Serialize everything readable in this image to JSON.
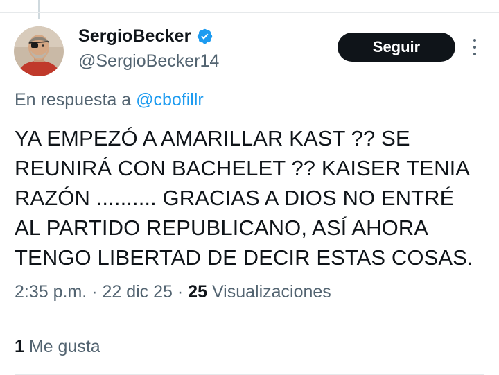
{
  "author": {
    "display_name": "SergioBecker",
    "handle": "@SergioBecker14",
    "verified": true,
    "verified_color": "#1d9bf0"
  },
  "follow_button": {
    "label": "Seguir"
  },
  "more_icon": "more-horizontal-dots-icon",
  "reply_context": {
    "prefix": "En respuesta a",
    "mention": "@cbofillr"
  },
  "tweet": {
    "text": "YA EMPEZÓ A AMARILLAR KAST ?? SE\nREUNIRÁ CON BACHELET ??  KAISER TENIA\nRAZÓN .......... GRACIAS A DIOS NO ENTRÉ\nAL PARTIDO REPUBLICANO, ASÍ AHORA\nTENGO LIBERTAD DE DECIR ESTAS COSAS."
  },
  "meta": {
    "time": "2:35 p.m.",
    "separator": "·",
    "date": "22 dic 25",
    "views_count": "25",
    "views_label": "Visualizaciones"
  },
  "engagement": {
    "likes_count": "1",
    "likes_label": "Me gusta"
  },
  "colors": {
    "text_primary": "#0f1419",
    "text_secondary": "#536471",
    "link": "#1d9bf0",
    "divider": "#e6e9eb"
  }
}
